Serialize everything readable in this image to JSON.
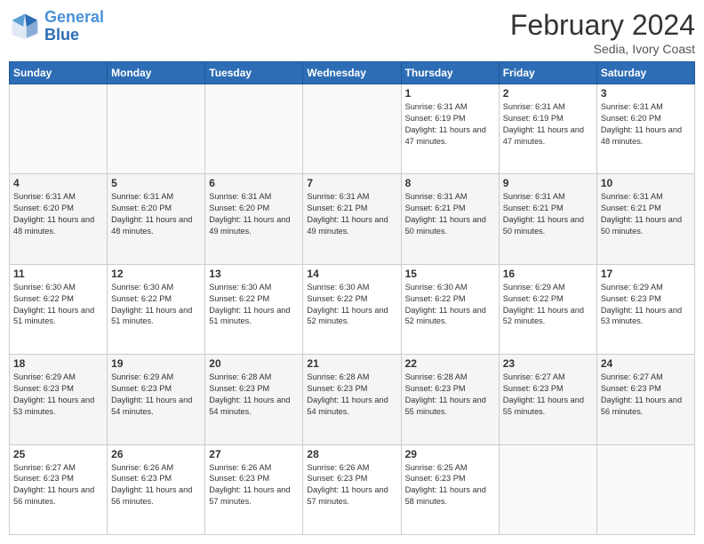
{
  "header": {
    "logo_line1": "General",
    "logo_line2": "Blue",
    "month_year": "February 2024",
    "location": "Sedia, Ivory Coast"
  },
  "days_of_week": [
    "Sunday",
    "Monday",
    "Tuesday",
    "Wednesday",
    "Thursday",
    "Friday",
    "Saturday"
  ],
  "weeks": [
    [
      {
        "num": "",
        "info": ""
      },
      {
        "num": "",
        "info": ""
      },
      {
        "num": "",
        "info": ""
      },
      {
        "num": "",
        "info": ""
      },
      {
        "num": "1",
        "info": "Sunrise: 6:31 AM\nSunset: 6:19 PM\nDaylight: 11 hours and 47 minutes."
      },
      {
        "num": "2",
        "info": "Sunrise: 6:31 AM\nSunset: 6:19 PM\nDaylight: 11 hours and 47 minutes."
      },
      {
        "num": "3",
        "info": "Sunrise: 6:31 AM\nSunset: 6:20 PM\nDaylight: 11 hours and 48 minutes."
      }
    ],
    [
      {
        "num": "4",
        "info": "Sunrise: 6:31 AM\nSunset: 6:20 PM\nDaylight: 11 hours and 48 minutes."
      },
      {
        "num": "5",
        "info": "Sunrise: 6:31 AM\nSunset: 6:20 PM\nDaylight: 11 hours and 48 minutes."
      },
      {
        "num": "6",
        "info": "Sunrise: 6:31 AM\nSunset: 6:20 PM\nDaylight: 11 hours and 49 minutes."
      },
      {
        "num": "7",
        "info": "Sunrise: 6:31 AM\nSunset: 6:21 PM\nDaylight: 11 hours and 49 minutes."
      },
      {
        "num": "8",
        "info": "Sunrise: 6:31 AM\nSunset: 6:21 PM\nDaylight: 11 hours and 50 minutes."
      },
      {
        "num": "9",
        "info": "Sunrise: 6:31 AM\nSunset: 6:21 PM\nDaylight: 11 hours and 50 minutes."
      },
      {
        "num": "10",
        "info": "Sunrise: 6:31 AM\nSunset: 6:21 PM\nDaylight: 11 hours and 50 minutes."
      }
    ],
    [
      {
        "num": "11",
        "info": "Sunrise: 6:30 AM\nSunset: 6:22 PM\nDaylight: 11 hours and 51 minutes."
      },
      {
        "num": "12",
        "info": "Sunrise: 6:30 AM\nSunset: 6:22 PM\nDaylight: 11 hours and 51 minutes."
      },
      {
        "num": "13",
        "info": "Sunrise: 6:30 AM\nSunset: 6:22 PM\nDaylight: 11 hours and 51 minutes."
      },
      {
        "num": "14",
        "info": "Sunrise: 6:30 AM\nSunset: 6:22 PM\nDaylight: 11 hours and 52 minutes."
      },
      {
        "num": "15",
        "info": "Sunrise: 6:30 AM\nSunset: 6:22 PM\nDaylight: 11 hours and 52 minutes."
      },
      {
        "num": "16",
        "info": "Sunrise: 6:29 AM\nSunset: 6:22 PM\nDaylight: 11 hours and 52 minutes."
      },
      {
        "num": "17",
        "info": "Sunrise: 6:29 AM\nSunset: 6:23 PM\nDaylight: 11 hours and 53 minutes."
      }
    ],
    [
      {
        "num": "18",
        "info": "Sunrise: 6:29 AM\nSunset: 6:23 PM\nDaylight: 11 hours and 53 minutes."
      },
      {
        "num": "19",
        "info": "Sunrise: 6:29 AM\nSunset: 6:23 PM\nDaylight: 11 hours and 54 minutes."
      },
      {
        "num": "20",
        "info": "Sunrise: 6:28 AM\nSunset: 6:23 PM\nDaylight: 11 hours and 54 minutes."
      },
      {
        "num": "21",
        "info": "Sunrise: 6:28 AM\nSunset: 6:23 PM\nDaylight: 11 hours and 54 minutes."
      },
      {
        "num": "22",
        "info": "Sunrise: 6:28 AM\nSunset: 6:23 PM\nDaylight: 11 hours and 55 minutes."
      },
      {
        "num": "23",
        "info": "Sunrise: 6:27 AM\nSunset: 6:23 PM\nDaylight: 11 hours and 55 minutes."
      },
      {
        "num": "24",
        "info": "Sunrise: 6:27 AM\nSunset: 6:23 PM\nDaylight: 11 hours and 56 minutes."
      }
    ],
    [
      {
        "num": "25",
        "info": "Sunrise: 6:27 AM\nSunset: 6:23 PM\nDaylight: 11 hours and 56 minutes."
      },
      {
        "num": "26",
        "info": "Sunrise: 6:26 AM\nSunset: 6:23 PM\nDaylight: 11 hours and 56 minutes."
      },
      {
        "num": "27",
        "info": "Sunrise: 6:26 AM\nSunset: 6:23 PM\nDaylight: 11 hours and 57 minutes."
      },
      {
        "num": "28",
        "info": "Sunrise: 6:26 AM\nSunset: 6:23 PM\nDaylight: 11 hours and 57 minutes."
      },
      {
        "num": "29",
        "info": "Sunrise: 6:25 AM\nSunset: 6:23 PM\nDaylight: 11 hours and 58 minutes."
      },
      {
        "num": "",
        "info": ""
      },
      {
        "num": "",
        "info": ""
      }
    ]
  ]
}
